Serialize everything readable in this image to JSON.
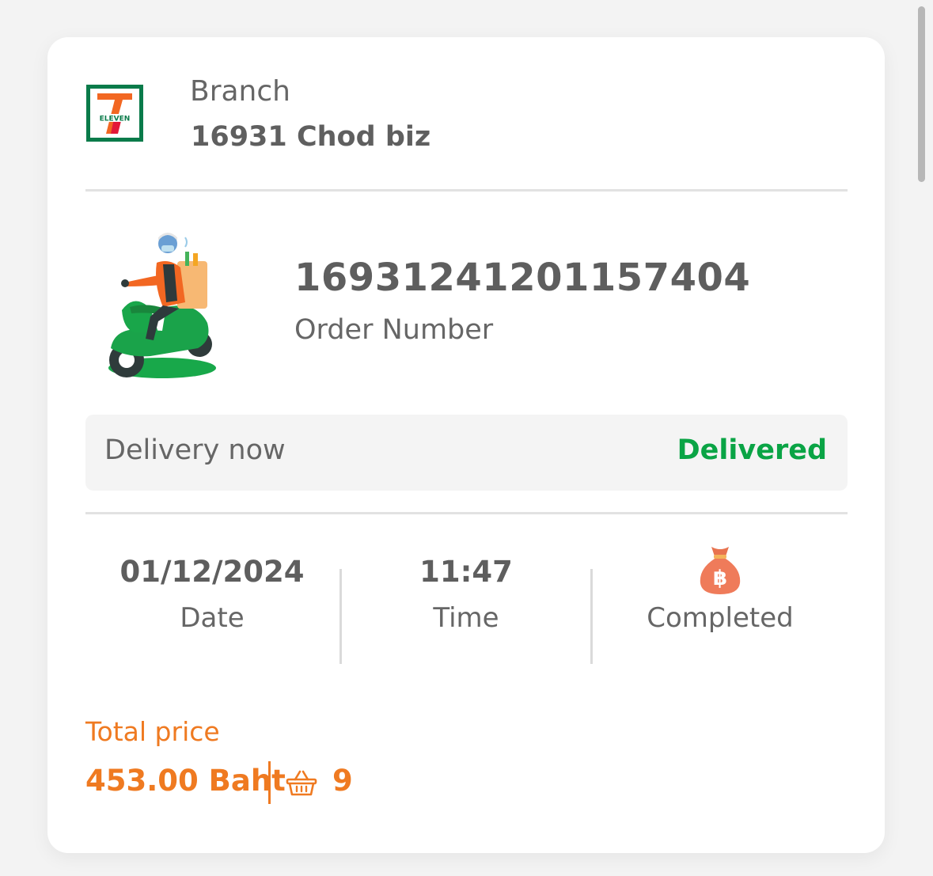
{
  "branch": {
    "label": "Branch",
    "name": "16931 Chod biz",
    "logo_text": "ELEVEN",
    "logo_icon": "seven-eleven-logo-icon"
  },
  "order": {
    "number": "16931241201157404",
    "label": "Order Number",
    "illustration_icon": "delivery-scooter-icon"
  },
  "delivery": {
    "type": "Delivery now",
    "status": "Delivered"
  },
  "stats": {
    "date": {
      "value": "01/12/2024",
      "label": "Date"
    },
    "time": {
      "value": "11:47",
      "label": "Time"
    },
    "payment": {
      "icon": "money-bag-baht-icon",
      "label": "Completed"
    }
  },
  "total": {
    "label": "Total price",
    "price": "453.00 Baht",
    "basket_icon": "basket-icon",
    "item_count": "9"
  },
  "colors": {
    "accent_orange": "#ef7a21",
    "status_green": "#0aa445",
    "text_gray": "#616161"
  }
}
